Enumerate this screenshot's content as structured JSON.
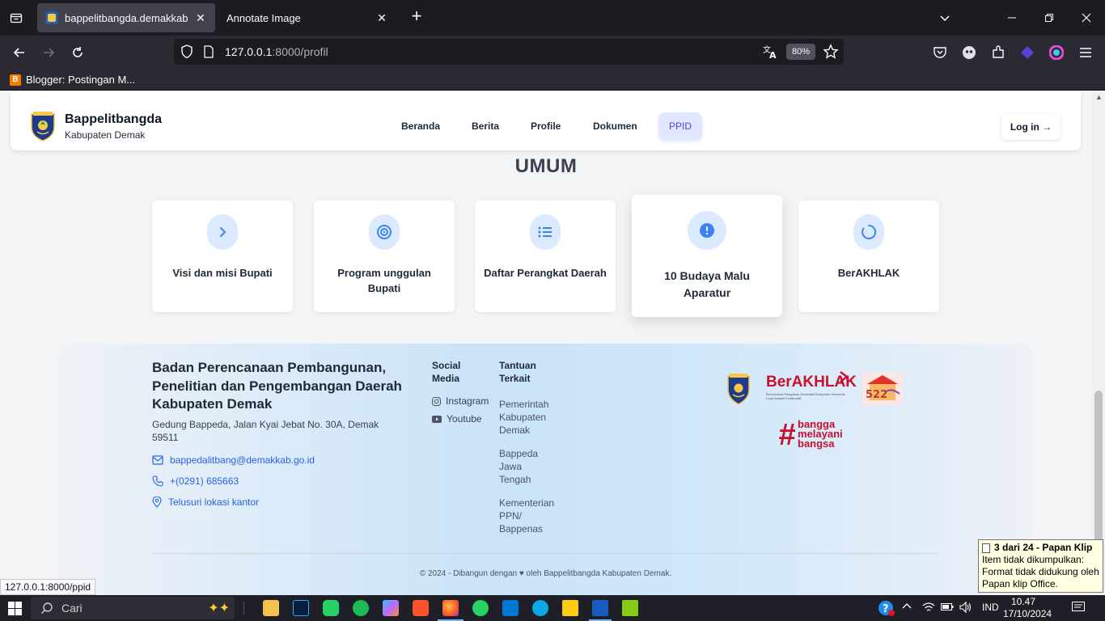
{
  "browser": {
    "tabs": [
      {
        "label": "bappelitbangda.demakkab",
        "active": true
      },
      {
        "label": "Annotate Image",
        "active": false
      }
    ],
    "url_host": "127.0.0.1",
    "url_path": ":8000/profil",
    "zoom": "80%",
    "bookmarks": [
      {
        "label": "Blogger: Postingan M..."
      }
    ],
    "status_url": "127.0.0.1:8000/ppid"
  },
  "site": {
    "brand_title": "Bappelitbangda",
    "brand_subtitle": "Kabupaten Demak",
    "nav": [
      {
        "label": "Beranda"
      },
      {
        "label": "Berita"
      },
      {
        "label": "Profile"
      },
      {
        "label": "Dokumen"
      },
      {
        "label": "PPID",
        "active": true
      }
    ],
    "login_label": "Log in →"
  },
  "section": {
    "title": "UMUM",
    "cards": [
      {
        "label": "Visi dan misi Bupati",
        "icon": "chevron-right-icon"
      },
      {
        "label": "Program unggulan Bupati",
        "icon": "target-icon"
      },
      {
        "label": "Daftar Perangkat Daerah",
        "icon": "list-icon"
      },
      {
        "label": "10 Budaya Malu Aparatur",
        "icon": "alert-circle-icon"
      },
      {
        "label": "BerAKHLAK",
        "icon": "loader-icon"
      }
    ]
  },
  "footer": {
    "org_name": "Badan Perencanaan Pembangunan, Penelitian dan Pengembangan Daerah Kabupaten Demak",
    "address": "Gedung Bappeda, Jalan Kyai Jebat No. 30A, Demak 59511",
    "email": "bappedalitbang@demakkab.go.id",
    "phone": "+(0291) 685663",
    "location_link": "Telusuri lokasi kantor",
    "social_title": "Social Media",
    "social": [
      {
        "label": "Instagram"
      },
      {
        "label": "Youtube"
      }
    ],
    "links_title": "Tantuan Terkait",
    "links": [
      {
        "label": "Pemerintah Kabupaten Demak"
      },
      {
        "label": "Bappeda Jawa Tengah"
      },
      {
        "label": "Kementerian PPN/ Bappenas"
      }
    ],
    "logos": {
      "berakhlak": "BerAKHLAK",
      "berakhlak_tagline": "Berorientasi Pelayanan Akuntabel Kompeten Harmonis Loyal Adaptif Kolaboratif",
      "bangga": [
        "bangga",
        "melayani",
        "bangsa"
      ]
    },
    "copyright": "© 2024 - Dibangun dengan ♥ oleh Bappelitbangda Kabupaten Demak."
  },
  "clipboard_toast": {
    "title": "3 dari 24 - Papan Klip",
    "body": "Item tidak dikumpulkan: Format tidak didukung oleh Papan klip Office."
  },
  "taskbar": {
    "search_placeholder": "Cari",
    "language": "IND",
    "time": "10.47",
    "date": "17/10/2024"
  },
  "colors": {
    "accent": "#2563eb",
    "nav_active_bg": "#e0e7ff",
    "nav_active_text": "#4f46e5",
    "icon_circle_bg": "#dbeafe"
  }
}
